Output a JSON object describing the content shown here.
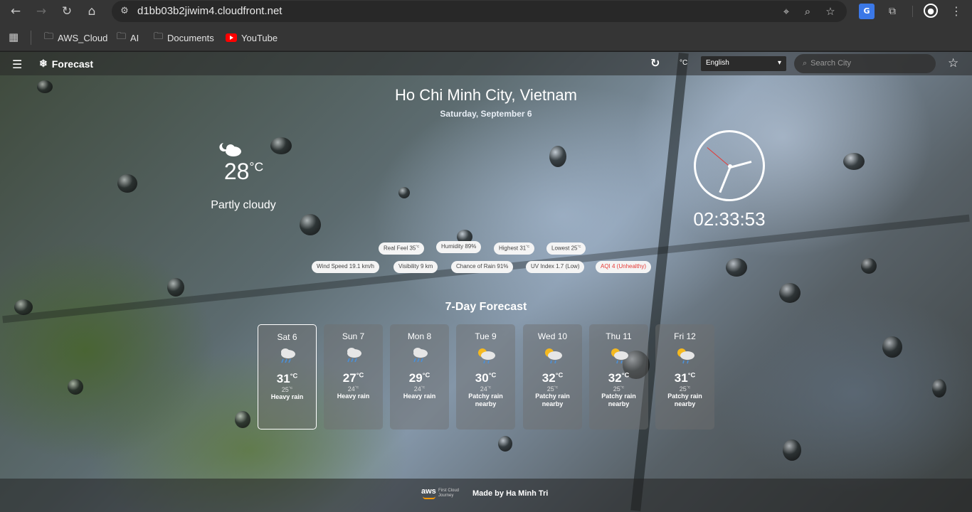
{
  "browser": {
    "url": "d1bb03b2jiwim4.cloudfront.net",
    "bookmarks": [
      {
        "label": "AWS_Cloud"
      },
      {
        "label": "AI"
      },
      {
        "label": "Documents"
      },
      {
        "label": "YouTube"
      }
    ]
  },
  "nav": {
    "brand": "Forecast",
    "unit": "°C",
    "language": "English",
    "search_placeholder": "Search City"
  },
  "location": {
    "city": "Ho Chi Minh City, Vietnam",
    "date": "Saturday, September 6"
  },
  "current": {
    "icon": "partly-cloudy-night-icon",
    "temp": "28",
    "unit": "°C",
    "condition": "Partly cloudy"
  },
  "clock": {
    "time": "02:33:53"
  },
  "stats_row1": [
    {
      "label": "Real Feel 35",
      "sup": "°C"
    },
    {
      "label": "Humidity 89%",
      "sup": ""
    },
    {
      "label": "Highest 31",
      "sup": "°C"
    },
    {
      "label": "Lowest 25",
      "sup": "°C"
    }
  ],
  "stats_row2": [
    {
      "label": "Wind Speed 19.1 km/h"
    },
    {
      "label": "Visibility 9 km"
    },
    {
      "label": "Chance of Rain 91%"
    },
    {
      "label": "UV Index 1.7 (Low)"
    },
    {
      "label": "AQI 4 (Unhealthy)",
      "color": "#e53935"
    }
  ],
  "forecast": {
    "title": "7-Day Forecast",
    "days": [
      {
        "day": "Sat 6",
        "high": "31",
        "low": "25",
        "cond": "Heavy rain",
        "icon": "heavy-rain-icon"
      },
      {
        "day": "Sun 7",
        "high": "27",
        "low": "24",
        "cond": "Heavy rain",
        "icon": "heavy-rain-icon"
      },
      {
        "day": "Mon 8",
        "high": "29",
        "low": "24",
        "cond": "Heavy rain",
        "icon": "heavy-rain-icon"
      },
      {
        "day": "Tue 9",
        "high": "30",
        "low": "24",
        "cond": "Patchy rain nearby",
        "icon": "patchy-rain-icon"
      },
      {
        "day": "Wed 10",
        "high": "32",
        "low": "25",
        "cond": "Patchy rain nearby",
        "icon": "patchy-rain-icon"
      },
      {
        "day": "Thu 11",
        "high": "32",
        "low": "25",
        "cond": "Patchy rain nearby",
        "icon": "patchy-rain-icon"
      },
      {
        "day": "Fri 12",
        "high": "31",
        "low": "25",
        "cond": "Patchy rain nearby",
        "icon": "patchy-rain-icon"
      }
    ],
    "unit": "°C"
  },
  "footer": {
    "logo_text": "aws",
    "logo_sub": "First Cloud Journey",
    "credit": "Made by Ha Minh Tri"
  }
}
